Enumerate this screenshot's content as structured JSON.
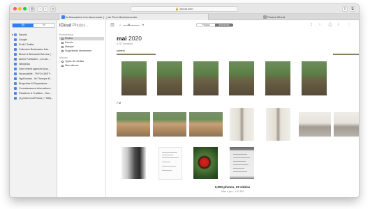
{
  "browser": {
    "url": "icloud.com",
    "tabs": [
      {
        "title": "Ils Marcadent à la découverte (...) du Tiers Machinevorder",
        "active": true
      },
      {
        "title": "Photos iCloud",
        "active": false
      }
    ]
  },
  "bookmarks": {
    "tabs": [
      "⊟",
      "∞"
    ],
    "root_label": "Favoris",
    "items": [
      "Google",
      "Profil / Twitter",
      "Collection Bookmarks finis...",
      "Bloom & Bernaude Bonnes (...",
      "Atelier Particulier - Le Lab...",
      "Wikipédia",
      "Votre relevé agencée (nou...",
      "Nounoulville - THYOL BNTY...",
      "HypDomain - Ile Thesque M...",
      "Bloquelles & Réparations...",
      "Connaissances informations...",
      "Réactions & Tradition - Nou...",
      "(1) photo iconPhotos (+ 35B)..."
    ]
  },
  "icloud": {
    "app_title": "iCloud",
    "app_name": "Photos",
    "library_label": "Photothèque",
    "library_items": [
      "Photos",
      "Favoris",
      "Masqué",
      "Supprimées récemment"
    ],
    "albums_label": "Albums",
    "album_items": [
      "Types de médias",
      "Mes albums"
    ]
  },
  "main": {
    "segments": [
      "Photos",
      "Moments"
    ],
    "active_segment": "Moments",
    "month": "mai",
    "year": "2020",
    "month_sub": "6 217 éléments",
    "section1": "samedi",
    "section2": "7 M",
    "footer_count": "2,093 photos, 23 vidéos",
    "footer_sub": "Mise à jour : 4:31 PM"
  },
  "colors": {
    "accent": "#2f7ff2",
    "selection": "#d6d6d6"
  }
}
